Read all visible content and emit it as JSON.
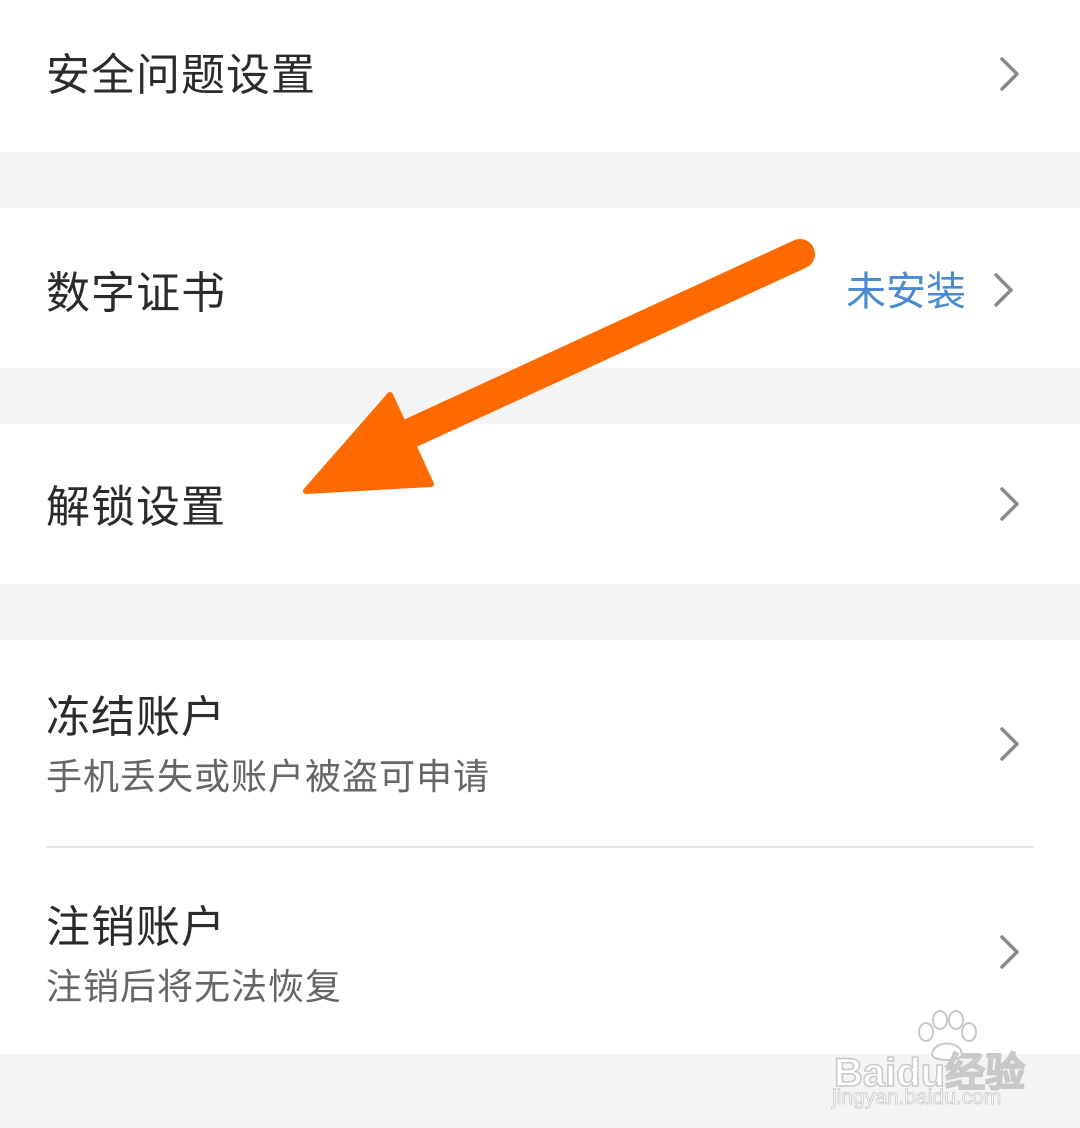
{
  "security_question": {
    "label": "安全问题设置"
  },
  "digital_certificate": {
    "label": "数字证书",
    "status": "未安装"
  },
  "unlock_settings": {
    "label": "解锁设置"
  },
  "freeze_account": {
    "label": "冻结账户",
    "description": "手机丢失或账户被盗可申请"
  },
  "cancel_account": {
    "label": "注销账户",
    "description": "注销后将无法恢复"
  },
  "watermark": {
    "brand": "Baidu经验",
    "url": "jingyan.baidu.com"
  },
  "colors": {
    "annotation_arrow": "#ff6a00",
    "status_text": "#4a8ad0",
    "background": "#f4f4f4",
    "card": "#ffffff"
  }
}
